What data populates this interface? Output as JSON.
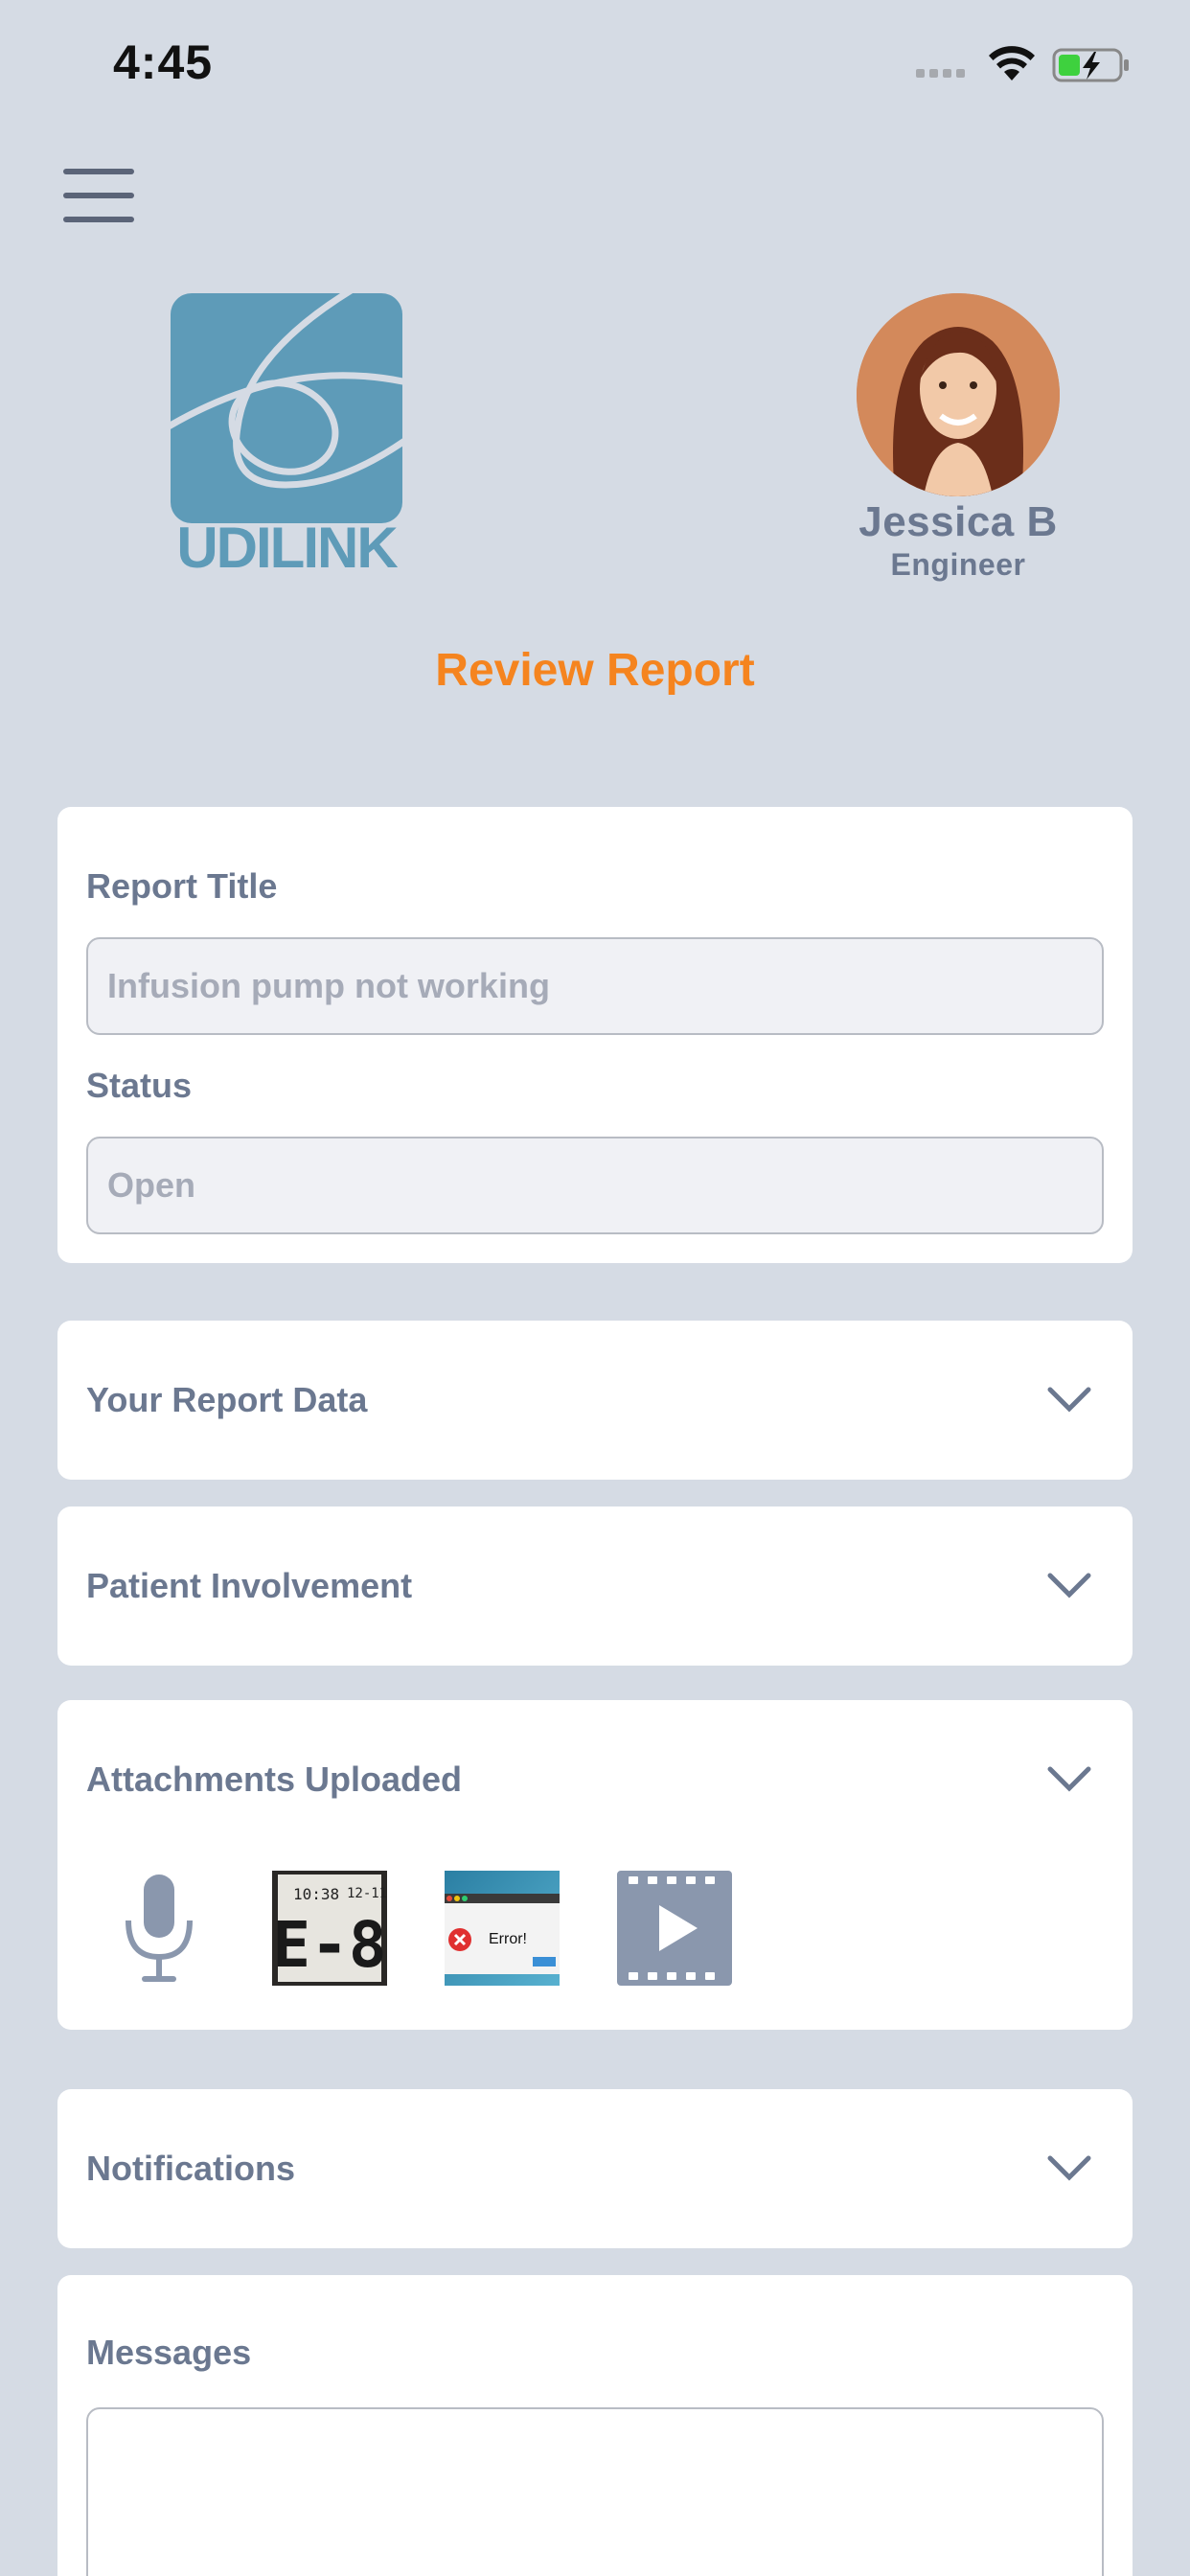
{
  "status_bar": {
    "time": "4:45"
  },
  "brand": {
    "logo_text": "UDILINK",
    "accent": "#5e9bb8"
  },
  "profile": {
    "name": "Jessica B",
    "role": "Engineer"
  },
  "page_title": "Review Report",
  "report": {
    "title_label": "Report Title",
    "title_value": "Infusion pump not working",
    "status_label": "Status",
    "status_value": "Open"
  },
  "sections": {
    "report_data": "Your Report Data",
    "patient": "Patient Involvement",
    "attachments": "Attachments Uploaded",
    "notifications": "Notifications",
    "messages": "Messages"
  },
  "attachments": {
    "items": [
      {
        "type": "audio",
        "icon": "microphone-icon"
      },
      {
        "type": "image",
        "icon": "display-e8-thumbnail",
        "text": "E-8"
      },
      {
        "type": "image",
        "icon": "error-screenshot-thumbnail",
        "text": "Error!"
      },
      {
        "type": "video",
        "icon": "video-play-icon"
      }
    ]
  },
  "colors": {
    "background": "#d5dbe4",
    "accent_orange": "#f5841f",
    "text": "#6b7890"
  }
}
